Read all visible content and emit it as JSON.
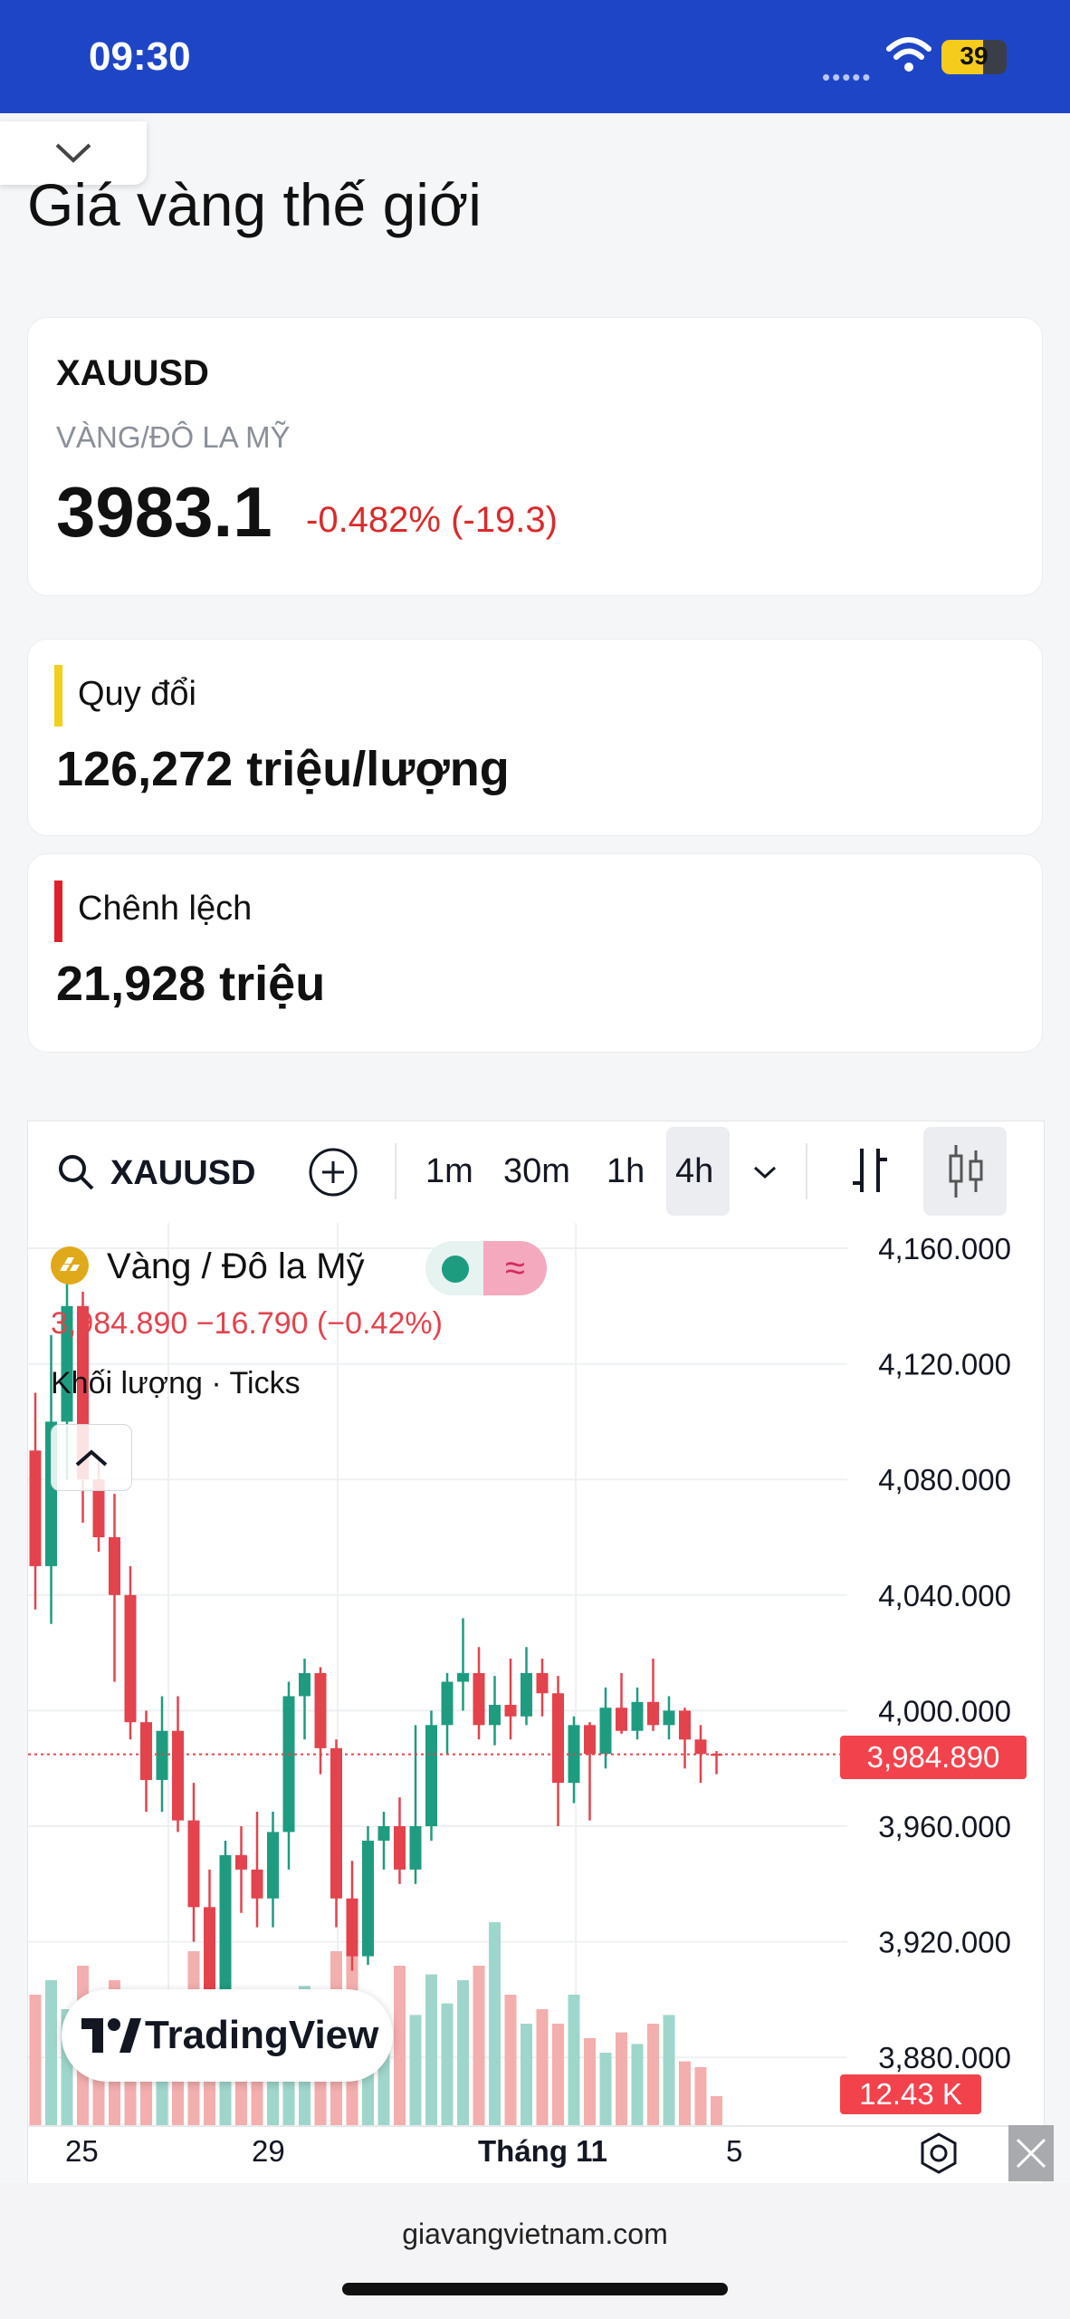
{
  "status": {
    "time": "09:30",
    "battery": "39"
  },
  "page": {
    "title": "Giá vàng thế giới",
    "site": "giavangvietnam.com"
  },
  "ticker": {
    "symbol": "XAUUSD",
    "name": "VÀNG/ĐÔ LA MỸ",
    "price": "3983.1",
    "change": "-0.482% (-19.3)"
  },
  "conversion": {
    "label": "Quy đổi",
    "value": "126,272 triệu/lượng"
  },
  "difference": {
    "label": "Chênh lệch",
    "value": "21,928 triệu"
  },
  "chart": {
    "symbol": "XAUUSD",
    "intervals": [
      "1m",
      "30m",
      "1h",
      "4h"
    ],
    "active_interval": "4h",
    "legend_title": "Vàng / Đô la Mỹ",
    "legend_values": "3,984.890  −16.790 (−0.42%)",
    "volume_label": "Khối lượng · Ticks",
    "price_tag": "3,984.890",
    "volume_tag": "12.43 K",
    "logo_text": "TradingView",
    "y_ticks": [
      "4,160.000",
      "4,120.000",
      "4,080.000",
      "4,040.000",
      "4,000.000",
      "3,960.000",
      "3,920.000",
      "3,880.000"
    ],
    "x_ticks": [
      "25",
      "29",
      "Tháng 11",
      "5"
    ],
    "colors": {
      "up": "#1e9c80",
      "down": "#e2434d",
      "up_vol": "#9fd6cb",
      "down_vol": "#f3aeae"
    }
  },
  "chart_data": {
    "type": "candlestick",
    "y_ticks": [
      4160,
      4120,
      4080,
      4040,
      4000,
      3960,
      3920,
      3880
    ],
    "x_ticks": [
      "25",
      "29",
      "Tháng 11",
      "5"
    ],
    "last_price": 3984.89,
    "last_volume": "12.43 K",
    "candles": [
      {
        "o": 4090,
        "h": 4110,
        "l": 4035,
        "c": 4050
      },
      {
        "o": 4050,
        "h": 4130,
        "l": 4030,
        "c": 4100
      },
      {
        "o": 4100,
        "h": 4150,
        "l": 4080,
        "c": 4140
      },
      {
        "o": 4140,
        "h": 4145,
        "l": 4065,
        "c": 4080
      },
      {
        "o": 4080,
        "h": 4088,
        "l": 4055,
        "c": 4060
      },
      {
        "o": 4060,
        "h": 4075,
        "l": 4010,
        "c": 4040
      },
      {
        "o": 4040,
        "h": 4050,
        "l": 3990,
        "c": 3996
      },
      {
        "o": 3996,
        "h": 4000,
        "l": 3965,
        "c": 3976
      },
      {
        "o": 3976,
        "h": 4005,
        "l": 3965,
        "c": 3993
      },
      {
        "o": 3993,
        "h": 4005,
        "l": 3958,
        "c": 3962
      },
      {
        "o": 3962,
        "h": 3975,
        "l": 3920,
        "c": 3932
      },
      {
        "o": 3932,
        "h": 3945,
        "l": 3885,
        "c": 3900
      },
      {
        "o": 3900,
        "h": 3955,
        "l": 3885,
        "c": 3950
      },
      {
        "o": 3950,
        "h": 3960,
        "l": 3930,
        "c": 3945
      },
      {
        "o": 3945,
        "h": 3965,
        "l": 3925,
        "c": 3935
      },
      {
        "o": 3935,
        "h": 3965,
        "l": 3925,
        "c": 3958
      },
      {
        "o": 3958,
        "h": 4010,
        "l": 3945,
        "c": 4005
      },
      {
        "o": 4005,
        "h": 4018,
        "l": 3990,
        "c": 4013
      },
      {
        "o": 4013,
        "h": 4015,
        "l": 3978,
        "c": 3987
      },
      {
        "o": 3987,
        "h": 3990,
        "l": 3925,
        "c": 3935
      },
      {
        "o": 3935,
        "h": 3948,
        "l": 3910,
        "c": 3915
      },
      {
        "o": 3915,
        "h": 3960,
        "l": 3912,
        "c": 3955
      },
      {
        "o": 3955,
        "h": 3965,
        "l": 3945,
        "c": 3960
      },
      {
        "o": 3960,
        "h": 3970,
        "l": 3940,
        "c": 3945
      },
      {
        "o": 3945,
        "h": 3995,
        "l": 3940,
        "c": 3960
      },
      {
        "o": 3960,
        "h": 4000,
        "l": 3955,
        "c": 3995
      },
      {
        "o": 3995,
        "h": 4013,
        "l": 3985,
        "c": 4010
      },
      {
        "o": 4010,
        "h": 4032,
        "l": 4000,
        "c": 4013
      },
      {
        "o": 4013,
        "h": 4022,
        "l": 3990,
        "c": 3995
      },
      {
        "o": 3995,
        "h": 4012,
        "l": 3988,
        "c": 4002
      },
      {
        "o": 4002,
        "h": 4018,
        "l": 3990,
        "c": 3998
      },
      {
        "o": 3998,
        "h": 4022,
        "l": 3995,
        "c": 4013
      },
      {
        "o": 4013,
        "h": 4018,
        "l": 3998,
        "c": 4006
      },
      {
        "o": 4006,
        "h": 4012,
        "l": 3960,
        "c": 3975
      },
      {
        "o": 3975,
        "h": 3998,
        "l": 3968,
        "c": 3995
      },
      {
        "o": 3995,
        "h": 3996,
        "l": 3962,
        "c": 3985
      },
      {
        "o": 3985,
        "h": 4008,
        "l": 3980,
        "c": 4001
      },
      {
        "o": 4001,
        "h": 4013,
        "l": 3992,
        "c": 3993
      },
      {
        "o": 3993,
        "h": 4008,
        "l": 3990,
        "c": 4003
      },
      {
        "o": 4003,
        "h": 4018,
        "l": 3993,
        "c": 3995
      },
      {
        "o": 3995,
        "h": 4005,
        "l": 3990,
        "c": 4000
      },
      {
        "o": 4000,
        "h": 4001,
        "l": 3980,
        "c": 3990
      },
      {
        "o": 3990,
        "h": 3995,
        "l": 3975,
        "c": 3985
      },
      {
        "o": 3985,
        "h": 3986,
        "l": 3978,
        "c": 3984.89
      }
    ],
    "volumes": [
      45,
      50,
      40,
      55,
      45,
      50,
      40,
      45,
      40,
      45,
      60,
      35,
      40,
      38,
      40,
      42,
      38,
      48,
      42,
      60,
      65,
      40,
      35,
      55,
      38,
      52,
      42,
      50,
      55,
      70,
      45,
      35,
      40,
      35,
      45,
      30,
      25,
      32,
      28,
      35,
      38,
      22,
      20,
      10
    ]
  }
}
